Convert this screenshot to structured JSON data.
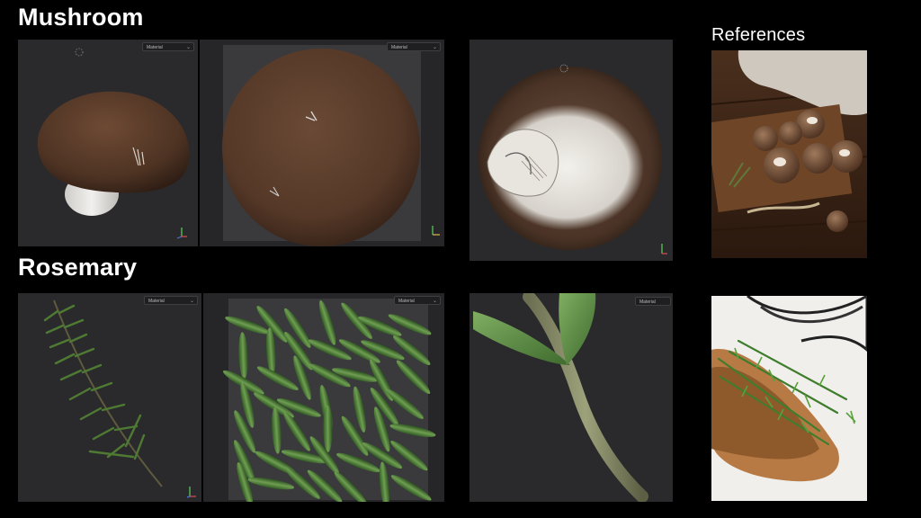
{
  "sections": {
    "mushroom_title": "Mushroom",
    "rosemary_title": "Rosemary",
    "references_title": "References"
  },
  "viewports": {
    "dropdown_label": "Material"
  },
  "icons": [
    "loading-spinner-icon",
    "axis-gizmo-icon",
    "chevron-down-icon"
  ],
  "colors": {
    "background": "#000000",
    "panel": "#2a2a2c",
    "mushroom_cap": "#5a3d2c",
    "mushroom_stem": "#e6e4e0",
    "rosemary_green": "#3f6a2c"
  }
}
